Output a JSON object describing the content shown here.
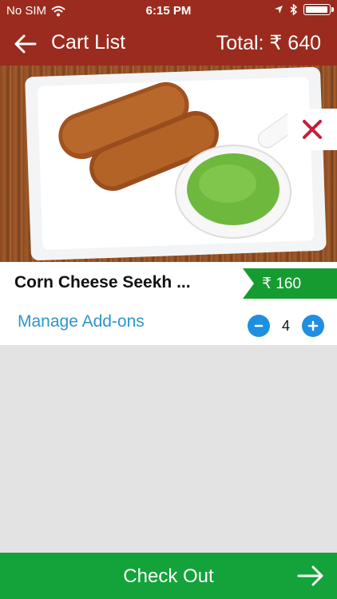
{
  "status_bar": {
    "carrier": "No SIM",
    "time": "6:15 PM",
    "battery_level": 1.0
  },
  "header": {
    "title": "Cart List",
    "total_label": "Total: ₹ 640"
  },
  "items": [
    {
      "name": "Corn Cheese Seekh ...",
      "price": "₹ 160",
      "manage_addons_label": "Manage Add-ons",
      "quantity": "4"
    }
  ],
  "footer": {
    "checkout_label": "Check Out"
  },
  "colors": {
    "header_bg": "#9a2b1e",
    "price_tag": "#159c31",
    "checkout_bg": "#13a33a",
    "link": "#2e95c7",
    "stepper": "#1f8fe0",
    "remove": "#c41e3a"
  },
  "icons": [
    "wifi-icon",
    "location-arrow-icon",
    "bluetooth-icon",
    "battery-icon",
    "back-arrow-icon",
    "remove-icon",
    "minus-icon",
    "plus-icon",
    "forward-arrow-icon"
  ]
}
